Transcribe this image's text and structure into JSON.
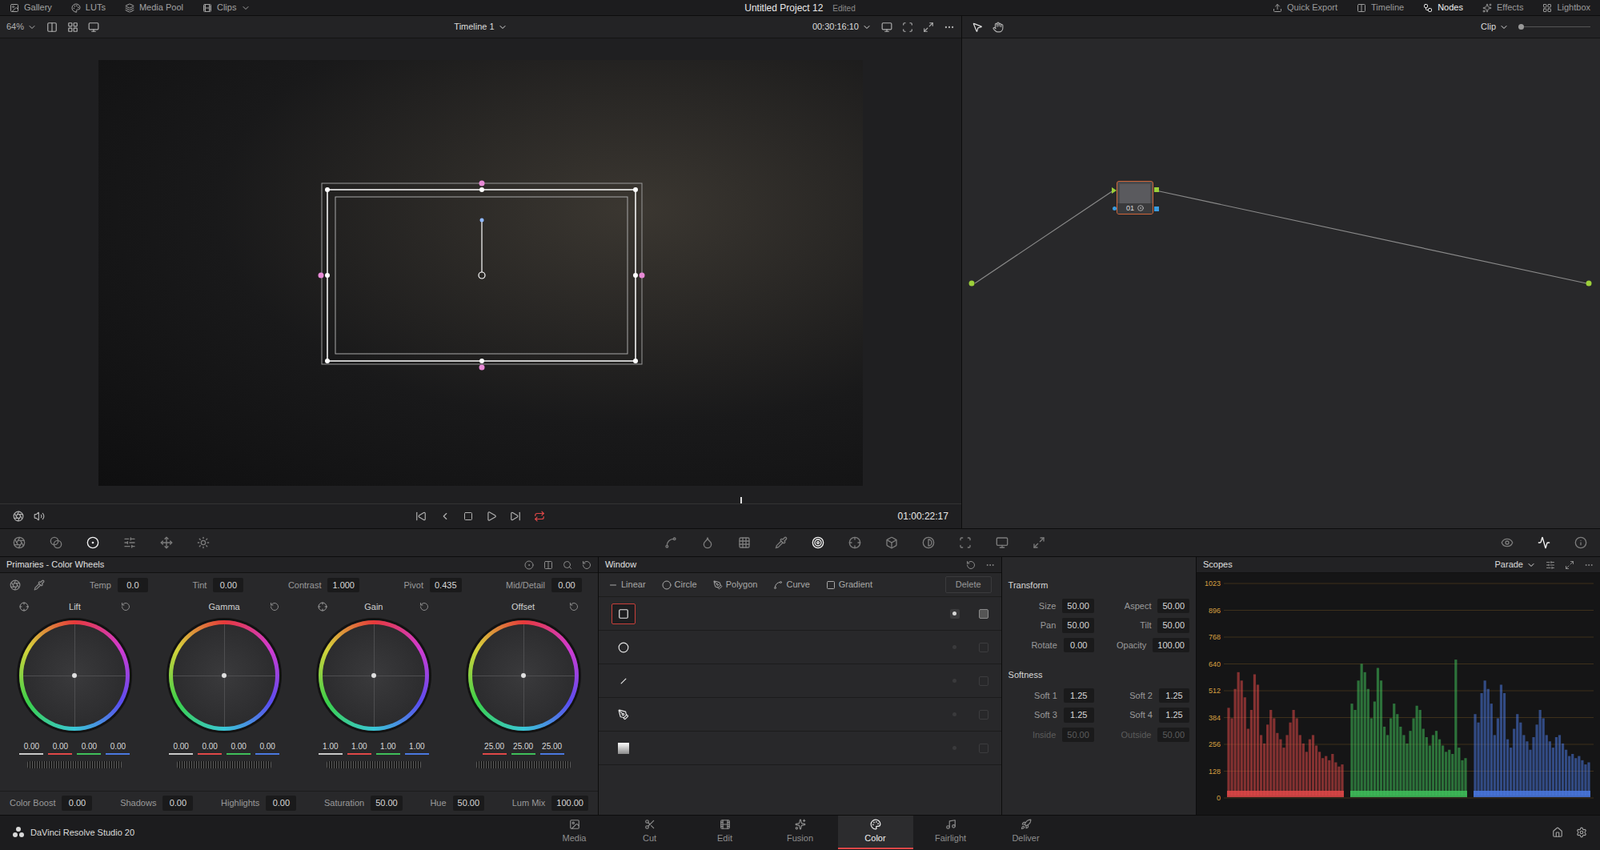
{
  "top_bar": {
    "left": [
      {
        "label": "Gallery",
        "dropdown": false
      },
      {
        "label": "LUTs",
        "dropdown": false
      },
      {
        "label": "Media Pool",
        "dropdown": false
      },
      {
        "label": "Clips",
        "dropdown": true
      }
    ],
    "title": "Untitled Project 12",
    "status": "Edited",
    "right": [
      {
        "label": "Quick Export",
        "selected": false
      },
      {
        "label": "Timeline",
        "selected": false
      },
      {
        "label": "Nodes",
        "selected": true
      },
      {
        "label": "Effects",
        "selected": false
      },
      {
        "label": "Lightbox",
        "selected": false
      }
    ]
  },
  "viewer": {
    "zoom": "64%",
    "timeline": "Timeline 1",
    "duration": "00:30:16:10",
    "timecode": "01:00:22:17",
    "playhead_level": 0.77,
    "loop_on": true
  },
  "node_editor": {
    "mode": "Clip",
    "nodes": [
      {
        "label": "01",
        "selected": true
      }
    ]
  },
  "palette_tools": {
    "left": [
      {
        "selected": false
      },
      {
        "selected": false
      },
      {
        "selected": true
      },
      {
        "selected": false
      },
      {
        "selected": false
      },
      {
        "selected": false
      }
    ],
    "center": [
      {
        "selected": false
      },
      {
        "selected": false
      },
      {
        "selected": false
      },
      {
        "selected": false
      },
      {
        "selected": true
      },
      {
        "selected": false
      },
      {
        "selected": false
      },
      {
        "selected": false
      },
      {
        "selected": false
      },
      {
        "selected": false
      },
      {
        "selected": false
      }
    ],
    "right": [
      {
        "selected": false
      },
      {
        "selected": true
      },
      {
        "selected": false
      }
    ]
  },
  "primaries": {
    "title": "Primaries - Color Wheels",
    "adjustments": [
      {
        "label": "Temp",
        "value": "0.0"
      },
      {
        "label": "Tint",
        "value": "0.00"
      },
      {
        "label": "Contrast",
        "value": "1.000"
      },
      {
        "label": "Pivot",
        "value": "0.435"
      },
      {
        "label": "Mid/Detail",
        "value": "0.00"
      }
    ],
    "wheels": [
      {
        "label": "Lift",
        "picker": true,
        "values": [
          {
            "value": "0.00",
            "color": "#c8c8c8"
          },
          {
            "value": "0.00",
            "color": "#e04848"
          },
          {
            "value": "0.00",
            "color": "#3fbf5a"
          },
          {
            "value": "0.00",
            "color": "#4a78e0"
          }
        ]
      },
      {
        "label": "Gamma",
        "picker": false,
        "values": [
          {
            "value": "0.00",
            "color": "#c8c8c8"
          },
          {
            "value": "0.00",
            "color": "#e04848"
          },
          {
            "value": "0.00",
            "color": "#3fbf5a"
          },
          {
            "value": "0.00",
            "color": "#4a78e0"
          }
        ]
      },
      {
        "label": "Gain",
        "picker": true,
        "values": [
          {
            "value": "1.00",
            "color": "#c8c8c8"
          },
          {
            "value": "1.00",
            "color": "#e04848"
          },
          {
            "value": "1.00",
            "color": "#3fbf5a"
          },
          {
            "value": "1.00",
            "color": "#4a78e0"
          }
        ]
      },
      {
        "label": "Offset",
        "picker": false,
        "values": [
          {
            "value": "25.00",
            "color": "#e04848"
          },
          {
            "value": "25.00",
            "color": "#3fbf5a"
          },
          {
            "value": "25.00",
            "color": "#4a78e0"
          }
        ]
      }
    ],
    "bottom": [
      {
        "label": "Color Boost",
        "value": "0.00"
      },
      {
        "label": "Shadows",
        "value": "0.00"
      },
      {
        "label": "Highlights",
        "value": "0.00"
      },
      {
        "label": "Saturation",
        "value": "50.00"
      },
      {
        "label": "Hue",
        "value": "50.00"
      },
      {
        "label": "Lum Mix",
        "value": "100.00"
      }
    ]
  },
  "window_panel": {
    "title": "Window",
    "tools": [
      {
        "label": "Linear"
      },
      {
        "label": "Circle"
      },
      {
        "label": "Polygon"
      },
      {
        "label": "Curve"
      },
      {
        "label": "Gradient"
      }
    ],
    "delete": "Delete",
    "windows": [
      {
        "kind": "square",
        "selected": true,
        "enabled": true
      },
      {
        "kind": "circle",
        "selected": false,
        "enabled": false
      },
      {
        "kind": "line",
        "selected": false,
        "enabled": false
      },
      {
        "kind": "pen",
        "selected": false,
        "enabled": false
      },
      {
        "kind": "gradient",
        "selected": false,
        "enabled": false
      }
    ]
  },
  "transform": {
    "title": "Transform",
    "fields": [
      {
        "label": "Size",
        "value": "50.00",
        "disabled": false
      },
      {
        "label": "Aspect",
        "value": "50.00",
        "disabled": false
      },
      {
        "label": "Pan",
        "value": "50.00",
        "disabled": false
      },
      {
        "label": "Tilt",
        "value": "50.00",
        "disabled": false
      },
      {
        "label": "Rotate",
        "value": "0.00",
        "disabled": false
      },
      {
        "label": "Opacity",
        "value": "100.00",
        "disabled": false
      }
    ],
    "softness_title": "Softness",
    "softness": [
      {
        "label": "Soft 1",
        "value": "1.25",
        "disabled": false
      },
      {
        "label": "Soft 2",
        "value": "1.25",
        "disabled": false
      },
      {
        "label": "Soft 3",
        "value": "1.25",
        "disabled": false
      },
      {
        "label": "Soft 4",
        "value": "1.25",
        "disabled": false
      },
      {
        "label": "Inside",
        "value": "50.00",
        "disabled": true
      },
      {
        "label": "Outside",
        "value": "50.00",
        "disabled": true
      }
    ]
  },
  "scopes": {
    "title": "Scopes",
    "mode": "Parade",
    "ticks": [
      "1023",
      "896",
      "768",
      "640",
      "512",
      "384",
      "256",
      "128",
      "0"
    ],
    "series": [
      {
        "color": "#e04848",
        "values": [
          430,
          380,
          520,
          600,
          560,
          480,
          330,
          420,
          590,
          540,
          300,
          260,
          350,
          420,
          380,
          310,
          280,
          240,
          300,
          360,
          420,
          380,
          300,
          260,
          220,
          280,
          300,
          250,
          220,
          190,
          200,
          180,
          210,
          170,
          150,
          160
        ]
      },
      {
        "color": "#3fbf5a",
        "values": [
          450,
          420,
          560,
          640,
          600,
          520,
          380,
          460,
          620,
          560,
          340,
          300,
          380,
          450,
          400,
          340,
          300,
          260,
          320,
          380,
          440,
          420,
          330,
          290,
          250,
          300,
          320,
          280,
          250,
          220,
          230,
          210,
          660,
          240,
          180,
          190
        ]
      },
      {
        "color": "#4a78e0",
        "values": [
          400,
          360,
          500,
          560,
          520,
          450,
          300,
          380,
          540,
          500,
          280,
          240,
          330,
          400,
          360,
          300,
          270,
          230,
          290,
          350,
          420,
          380,
          300,
          270,
          240,
          290,
          300,
          260,
          230,
          200,
          210,
          190,
          200,
          180,
          160,
          170
        ]
      }
    ]
  },
  "bottom_nav": {
    "app": "DaVinci Resolve Studio 20",
    "pages": [
      {
        "label": "Media",
        "selected": false
      },
      {
        "label": "Cut",
        "selected": false
      },
      {
        "label": "Edit",
        "selected": false
      },
      {
        "label": "Fusion",
        "selected": false
      },
      {
        "label": "Color",
        "selected": true
      },
      {
        "label": "Fairlight",
        "selected": false
      },
      {
        "label": "Deliver",
        "selected": false
      }
    ]
  }
}
